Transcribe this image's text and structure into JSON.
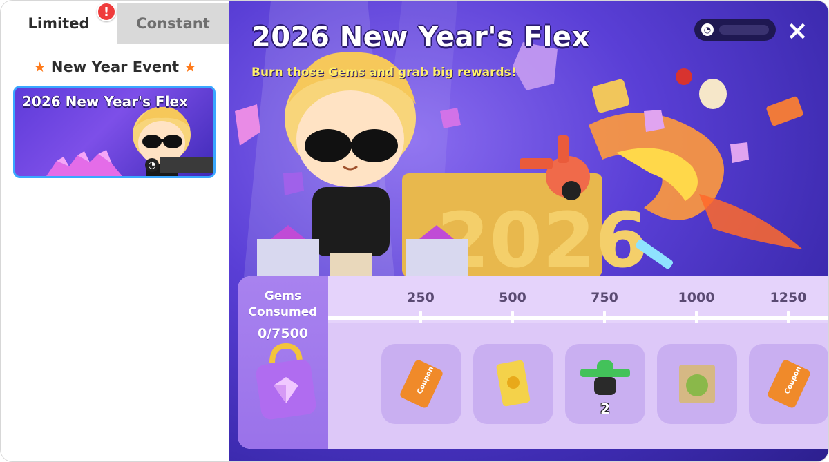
{
  "tabs": {
    "limited": "Limited",
    "constant": "Constant",
    "alert": "!"
  },
  "sidebar": {
    "heading": "New Year Event",
    "card_title": "2026 New Year's Flex"
  },
  "main": {
    "title": "2026 New Year's Flex",
    "subtitle": "Burn those Gems and grab big rewards!",
    "close_icon": "×"
  },
  "track": {
    "label": "Gems Consumed",
    "value": "0/7500",
    "milestones": [
      "250",
      "500",
      "750",
      "1000",
      "1250"
    ],
    "rewards": [
      {
        "icon": "coupon-icon",
        "count": ""
      },
      {
        "icon": "card-pack-icon",
        "count": ""
      },
      {
        "icon": "green-drone-icon",
        "count": "2"
      },
      {
        "icon": "durian-box-icon",
        "count": ""
      },
      {
        "icon": "coupon-icon",
        "count": ""
      }
    ]
  },
  "colors": {
    "accent_blue": "#3aa7ff",
    "badge_red": "#ef3b3b",
    "subtitle_yellow": "#fff06a",
    "track_purple": "#a882ef"
  }
}
